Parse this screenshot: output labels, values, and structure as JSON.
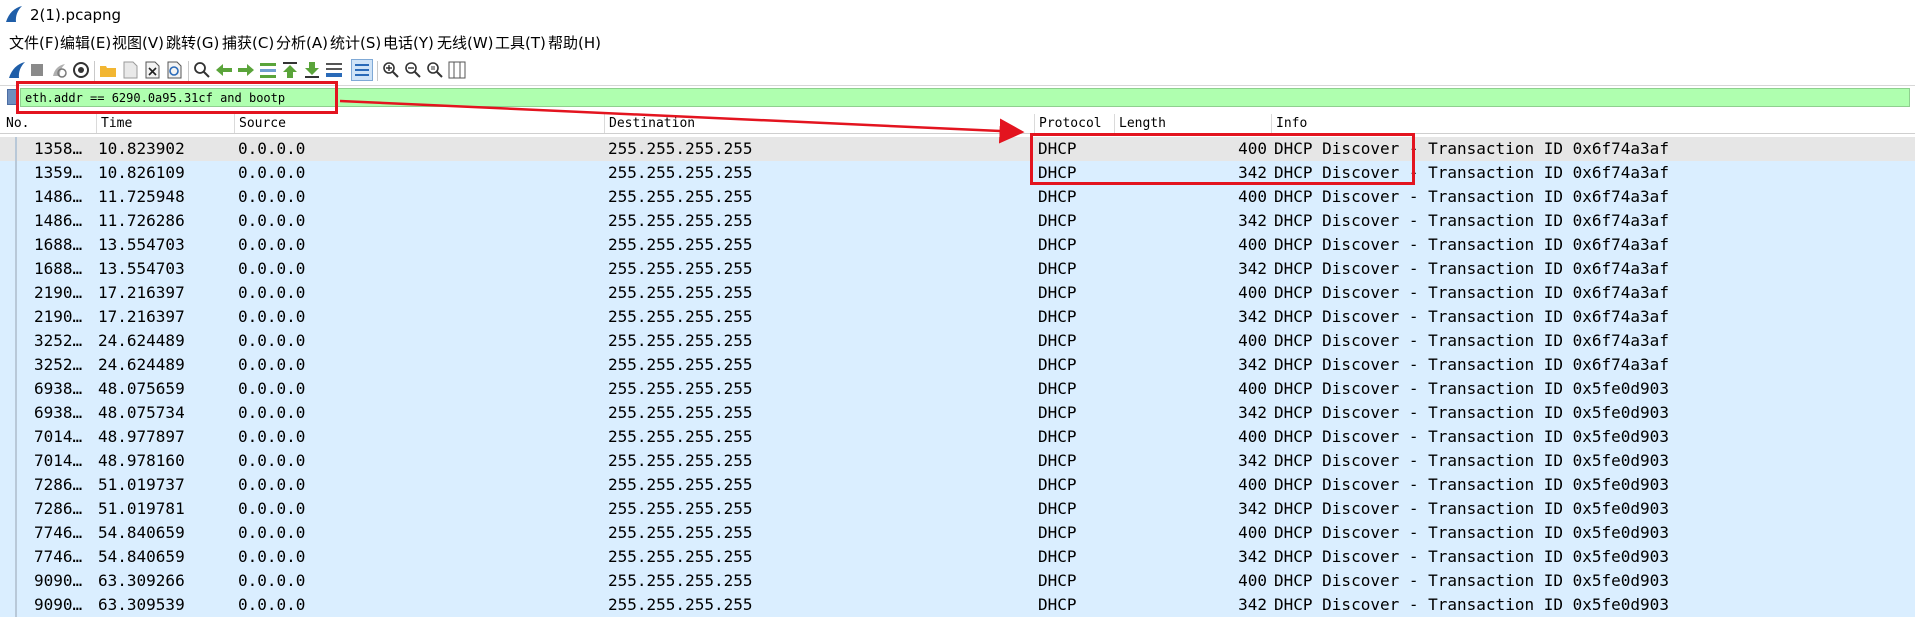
{
  "window": {
    "title": "2(1).pcapng"
  },
  "menu": [
    "文件(F)",
    "编辑(E)",
    "视图(V)",
    "跳转(G)",
    "捕获(C)",
    "分析(A)",
    "统计(S)",
    "电话(Y)",
    "无线(W)",
    "工具(T)",
    "帮助(H)"
  ],
  "toolbar": {
    "icons": [
      "shark-fin-start-icon",
      "stop-capture-icon",
      "restart-capture-icon",
      "capture-options-icon",
      "open-file-icon",
      "save-file-icon",
      "close-file-icon",
      "reload-file-icon",
      "find-packet-icon",
      "go-back-icon",
      "go-forward-icon",
      "go-to-packet-icon",
      "go-first-packet-icon",
      "go-last-packet-icon",
      "auto-scroll-icon",
      "colorize-icon",
      "zoom-in-icon",
      "zoom-out-icon",
      "normal-size-icon",
      "resize-columns-icon"
    ]
  },
  "filter": {
    "value": "eth.addr == 6290.0a95.31cf and bootp"
  },
  "columns": {
    "no": "No.",
    "time": "Time",
    "source": "Source",
    "destination": "Destination",
    "protocol": "Protocol",
    "length": "Length",
    "info": "Info"
  },
  "packets": [
    {
      "no": "1358…",
      "time": "10.823902",
      "source": "0.0.0.0",
      "destination": "255.255.255.255",
      "protocol": "DHCP",
      "length": "400",
      "info": "DHCP Discover - Transaction ID 0x6f74a3af"
    },
    {
      "no": "1359…",
      "time": "10.826109",
      "source": "0.0.0.0",
      "destination": "255.255.255.255",
      "protocol": "DHCP",
      "length": "342",
      "info": "DHCP Discover - Transaction ID 0x6f74a3af"
    },
    {
      "no": "1486…",
      "time": "11.725948",
      "source": "0.0.0.0",
      "destination": "255.255.255.255",
      "protocol": "DHCP",
      "length": "400",
      "info": "DHCP Discover - Transaction ID 0x6f74a3af"
    },
    {
      "no": "1486…",
      "time": "11.726286",
      "source": "0.0.0.0",
      "destination": "255.255.255.255",
      "protocol": "DHCP",
      "length": "342",
      "info": "DHCP Discover - Transaction ID 0x6f74a3af"
    },
    {
      "no": "1688…",
      "time": "13.554703",
      "source": "0.0.0.0",
      "destination": "255.255.255.255",
      "protocol": "DHCP",
      "length": "400",
      "info": "DHCP Discover - Transaction ID 0x6f74a3af"
    },
    {
      "no": "1688…",
      "time": "13.554703",
      "source": "0.0.0.0",
      "destination": "255.255.255.255",
      "protocol": "DHCP",
      "length": "342",
      "info": "DHCP Discover - Transaction ID 0x6f74a3af"
    },
    {
      "no": "2190…",
      "time": "17.216397",
      "source": "0.0.0.0",
      "destination": "255.255.255.255",
      "protocol": "DHCP",
      "length": "400",
      "info": "DHCP Discover - Transaction ID 0x6f74a3af"
    },
    {
      "no": "2190…",
      "time": "17.216397",
      "source": "0.0.0.0",
      "destination": "255.255.255.255",
      "protocol": "DHCP",
      "length": "342",
      "info": "DHCP Discover - Transaction ID 0x6f74a3af"
    },
    {
      "no": "3252…",
      "time": "24.624489",
      "source": "0.0.0.0",
      "destination": "255.255.255.255",
      "protocol": "DHCP",
      "length": "400",
      "info": "DHCP Discover - Transaction ID 0x6f74a3af"
    },
    {
      "no": "3252…",
      "time": "24.624489",
      "source": "0.0.0.0",
      "destination": "255.255.255.255",
      "protocol": "DHCP",
      "length": "342",
      "info": "DHCP Discover - Transaction ID 0x6f74a3af"
    },
    {
      "no": "6938…",
      "time": "48.075659",
      "source": "0.0.0.0",
      "destination": "255.255.255.255",
      "protocol": "DHCP",
      "length": "400",
      "info": "DHCP Discover - Transaction ID 0x5fe0d903"
    },
    {
      "no": "6938…",
      "time": "48.075734",
      "source": "0.0.0.0",
      "destination": "255.255.255.255",
      "protocol": "DHCP",
      "length": "342",
      "info": "DHCP Discover - Transaction ID 0x5fe0d903"
    },
    {
      "no": "7014…",
      "time": "48.977897",
      "source": "0.0.0.0",
      "destination": "255.255.255.255",
      "protocol": "DHCP",
      "length": "400",
      "info": "DHCP Discover - Transaction ID 0x5fe0d903"
    },
    {
      "no": "7014…",
      "time": "48.978160",
      "source": "0.0.0.0",
      "destination": "255.255.255.255",
      "protocol": "DHCP",
      "length": "342",
      "info": "DHCP Discover - Transaction ID 0x5fe0d903"
    },
    {
      "no": "7286…",
      "time": "51.019737",
      "source": "0.0.0.0",
      "destination": "255.255.255.255",
      "protocol": "DHCP",
      "length": "400",
      "info": "DHCP Discover - Transaction ID 0x5fe0d903"
    },
    {
      "no": "7286…",
      "time": "51.019781",
      "source": "0.0.0.0",
      "destination": "255.255.255.255",
      "protocol": "DHCP",
      "length": "342",
      "info": "DHCP Discover - Transaction ID 0x5fe0d903"
    },
    {
      "no": "7746…",
      "time": "54.840659",
      "source": "0.0.0.0",
      "destination": "255.255.255.255",
      "protocol": "DHCP",
      "length": "400",
      "info": "DHCP Discover - Transaction ID 0x5fe0d903"
    },
    {
      "no": "7746…",
      "time": "54.840659",
      "source": "0.0.0.0",
      "destination": "255.255.255.255",
      "protocol": "DHCP",
      "length": "342",
      "info": "DHCP Discover - Transaction ID 0x5fe0d903"
    },
    {
      "no": "9090…",
      "time": "63.309266",
      "source": "0.0.0.0",
      "destination": "255.255.255.255",
      "protocol": "DHCP",
      "length": "400",
      "info": "DHCP Discover - Transaction ID 0x5fe0d903"
    },
    {
      "no": "9090…",
      "time": "63.309539",
      "source": "0.0.0.0",
      "destination": "255.255.255.255",
      "protocol": "DHCP",
      "length": "342",
      "info": "DHCP Discover - Transaction ID 0x5fe0d903"
    }
  ],
  "colors": {
    "row": "#daeeff",
    "selected_row": "#e6e6e6",
    "filter_bg": "#afffaf",
    "annotation": "#e3141f"
  }
}
